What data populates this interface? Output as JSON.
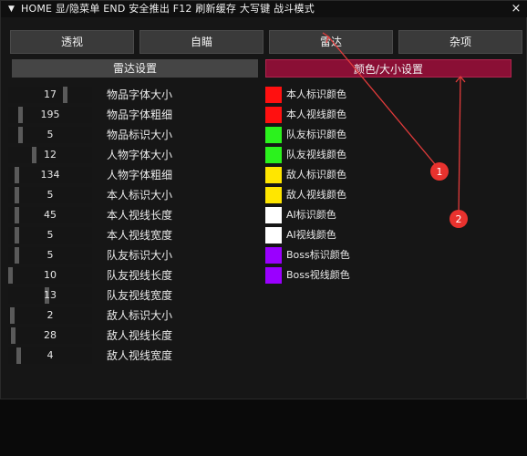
{
  "window": {
    "arrow": "▼",
    "title": "HOME 显/隐菜单  END 安全推出  F12 刷新缓存  大写键 战斗模式",
    "close": "×"
  },
  "tabs": [
    "透视",
    "自瞄",
    "雷达",
    "杂项"
  ],
  "subtabs": [
    "雷达设置",
    "颜色/大小设置"
  ],
  "sliders": [
    {
      "value": "17",
      "label": "物品字体大小",
      "fraction": 0.69
    },
    {
      "value": "195",
      "label": "物品字体粗细",
      "fraction": 0.13
    },
    {
      "value": "5",
      "label": "物品标识大小",
      "fraction": 0.13
    },
    {
      "value": "12",
      "label": "人物字体大小",
      "fraction": 0.3
    },
    {
      "value": "134",
      "label": "人物字体粗细",
      "fraction": 0.08
    },
    {
      "value": "5",
      "label": "本人标识大小",
      "fraction": 0.08
    },
    {
      "value": "45",
      "label": "本人视线长度",
      "fraction": 0.08
    },
    {
      "value": "5",
      "label": "本人视线宽度",
      "fraction": 0.08
    },
    {
      "value": "5",
      "label": "队友标识大小",
      "fraction": 0.08
    },
    {
      "value": "10",
      "label": "队友视线长度",
      "fraction": 0.0
    },
    {
      "value": "13",
      "label": "队友视线宽度",
      "fraction": 0.46
    },
    {
      "value": "2",
      "label": "敌人标识大小",
      "fraction": 0.02
    },
    {
      "value": "28",
      "label": "敌人视线长度",
      "fraction": 0.04
    },
    {
      "value": "4",
      "label": "敌人视线宽度",
      "fraction": 0.1
    }
  ],
  "colors": [
    {
      "label": "本人标识颜色",
      "color": "#ff1010"
    },
    {
      "label": "本人视线颜色",
      "color": "#ff1010"
    },
    {
      "label": "队友标识颜色",
      "color": "#2bf21d"
    },
    {
      "label": "队友视线颜色",
      "color": "#2bf21d"
    },
    {
      "label": "敌人标识颜色",
      "color": "#ffe600"
    },
    {
      "label": "敌人视线颜色",
      "color": "#ffe600"
    },
    {
      "label": "AI标识颜色",
      "color": "#ffffff"
    },
    {
      "label": "AI视线颜色",
      "color": "#ffffff"
    },
    {
      "label": "Boss标识颜色",
      "color": "#9a00ff"
    },
    {
      "label": "Boss视线颜色",
      "color": "#9a00ff"
    }
  ],
  "annotations": [
    "1",
    "2"
  ]
}
